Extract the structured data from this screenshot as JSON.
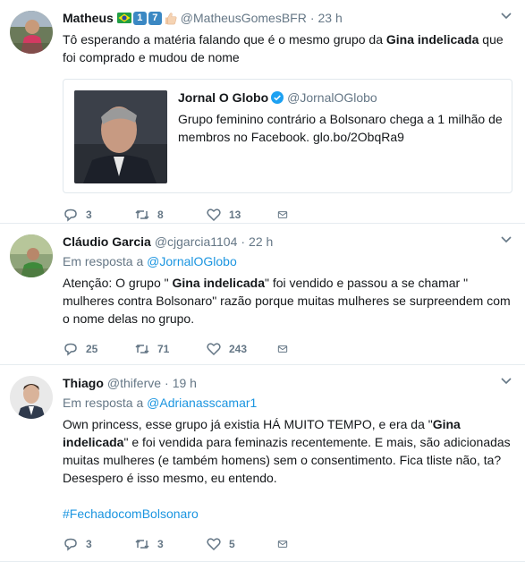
{
  "colors": {
    "link": "#1b95e0",
    "muted": "#657786",
    "text": "#14171a",
    "border": "#e6ecf0"
  },
  "tweets": [
    {
      "name": "Matheus",
      "emoji": [
        "brazil-flag",
        "keycap-1",
        "keycap-7",
        "thumbs-up"
      ],
      "keycaps": [
        "1",
        "7"
      ],
      "handle": "@MatheusGomesBFR",
      "dot": "·",
      "time": "23 h",
      "text_parts": [
        "Tô esperando a matéria falando que é o mesmo grupo da ",
        "Gina indelicada",
        " que foi comprado e mudou de nome"
      ],
      "card": {
        "name": "Jornal O Globo",
        "verified": true,
        "handle": "@JornalOGlobo",
        "text": "Grupo feminino contrário a Bolsonaro chega a 1 milhão de membros no Facebook. glo.bo/2ObqRa9"
      },
      "actions": {
        "replies": "3",
        "retweets": "8",
        "likes": "13"
      }
    },
    {
      "name": "Cláudio Garcia",
      "handle": "@cjgarcia1104",
      "dot": "·",
      "time": "22 h",
      "reply_prefix": "Em resposta a ",
      "reply_to": "@JornalOGlobo",
      "text_parts": [
        "Atenção: O grupo \" ",
        "Gina indelicada",
        "\" foi vendido e passou a se chamar \" mulheres contra Bolsonaro\" razão porque muitas mulheres se surpreendem com o nome delas no grupo."
      ],
      "actions": {
        "replies": "25",
        "retweets": "71",
        "likes": "243"
      }
    },
    {
      "name": "Thiago",
      "handle": "@thiferve",
      "dot": "·",
      "time": "19 h",
      "reply_prefix": "Em resposta a ",
      "reply_to": "@Adrianasscamar1",
      "text_parts": [
        "Own princess, esse grupo já existia HÁ MUITO TEMPO, e era da \"",
        "Gina indelicada",
        "\" e foi vendida para feminazis recentemente. E mais, são adicionadas muitas mulheres (e também homens) sem o consentimento. Fica tliste não, ta? Desespero é isso mesmo, eu entendo."
      ],
      "hashtag": "#FechadocomBolsonaro",
      "actions": {
        "replies": "3",
        "retweets": "3",
        "likes": "5"
      }
    }
  ]
}
